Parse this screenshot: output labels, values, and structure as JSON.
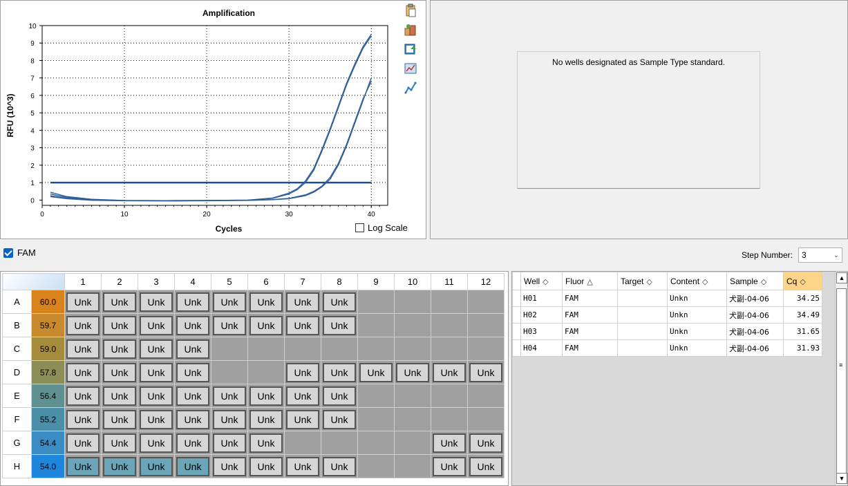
{
  "chart": {
    "title": "Amplification",
    "xlabel": "Cycles",
    "ylabel": "RFU (10^3)",
    "log_scale_label": "Log Scale",
    "log_scale_checked": false
  },
  "chart_data": {
    "type": "line",
    "title": "Amplification",
    "xlabel": "Cycles",
    "ylabel": "RFU (10^3)",
    "xlim": [
      0,
      42
    ],
    "ylim": [
      -0.3,
      10
    ],
    "xticks": [
      0,
      10,
      20,
      30,
      40
    ],
    "yticks": [
      0,
      1,
      2,
      3,
      4,
      5,
      6,
      7,
      8,
      9,
      10
    ],
    "grid": true,
    "threshold": 1.0,
    "series": [
      {
        "values": [
          [
            1,
            0.35
          ],
          [
            3,
            0.15
          ],
          [
            6,
            0.03
          ],
          [
            10,
            -0.02
          ],
          [
            15,
            -0.03
          ],
          [
            20,
            -0.02
          ],
          [
            25,
            0.0
          ],
          [
            28,
            0.1
          ],
          [
            30,
            0.35
          ],
          [
            31,
            0.6
          ],
          [
            32,
            1.0
          ],
          [
            33,
            1.7
          ],
          [
            34,
            2.8
          ],
          [
            35,
            4.0
          ],
          [
            36,
            5.3
          ],
          [
            37,
            6.6
          ],
          [
            38,
            7.7
          ],
          [
            39,
            8.7
          ],
          [
            40,
            9.4
          ]
        ]
      },
      {
        "values": [
          [
            1,
            0.45
          ],
          [
            3,
            0.2
          ],
          [
            6,
            0.05
          ],
          [
            10,
            -0.02
          ],
          [
            15,
            -0.03
          ],
          [
            20,
            -0.02
          ],
          [
            25,
            0.0
          ],
          [
            28,
            0.12
          ],
          [
            30,
            0.4
          ],
          [
            31,
            0.65
          ],
          [
            32,
            1.1
          ],
          [
            33,
            1.8
          ],
          [
            34,
            2.9
          ],
          [
            35,
            4.1
          ],
          [
            36,
            5.4
          ],
          [
            37,
            6.7
          ],
          [
            38,
            7.8
          ],
          [
            39,
            8.8
          ],
          [
            40,
            9.5
          ]
        ]
      },
      {
        "values": [
          [
            1,
            0.25
          ],
          [
            3,
            0.1
          ],
          [
            6,
            0.0
          ],
          [
            10,
            -0.03
          ],
          [
            15,
            -0.04
          ],
          [
            20,
            -0.03
          ],
          [
            25,
            -0.01
          ],
          [
            28,
            0.03
          ],
          [
            30,
            0.1
          ],
          [
            32,
            0.3
          ],
          [
            33,
            0.5
          ],
          [
            34,
            0.8
          ],
          [
            35,
            1.3
          ],
          [
            36,
            2.1
          ],
          [
            37,
            3.2
          ],
          [
            38,
            4.5
          ],
          [
            39,
            5.8
          ],
          [
            40,
            6.8
          ]
        ]
      },
      {
        "values": [
          [
            1,
            0.2
          ],
          [
            3,
            0.08
          ],
          [
            6,
            -0.01
          ],
          [
            10,
            -0.04
          ],
          [
            15,
            -0.05
          ],
          [
            20,
            -0.04
          ],
          [
            25,
            -0.02
          ],
          [
            28,
            0.02
          ],
          [
            30,
            0.08
          ],
          [
            32,
            0.25
          ],
          [
            33,
            0.45
          ],
          [
            34,
            0.75
          ],
          [
            35,
            1.2
          ],
          [
            36,
            2.0
          ],
          [
            37,
            3.1
          ],
          [
            38,
            4.4
          ],
          [
            39,
            5.7
          ],
          [
            40,
            7.0
          ]
        ]
      }
    ]
  },
  "std_curve_message": "No wells designated as Sample Type standard.",
  "fluor_filter": {
    "label": "FAM",
    "checked": true
  },
  "step_number": {
    "label": "Step Number:",
    "value": "3"
  },
  "plate": {
    "columns": [
      "1",
      "2",
      "3",
      "4",
      "5",
      "6",
      "7",
      "8",
      "9",
      "10",
      "11",
      "12"
    ],
    "rows": [
      {
        "label": "A",
        "temp": "60.0",
        "color": "#d8821c",
        "wells": [
          "Unk",
          "Unk",
          "Unk",
          "Unk",
          "Unk",
          "Unk",
          "Unk",
          "Unk",
          "",
          "",
          "",
          ""
        ]
      },
      {
        "label": "B",
        "temp": "59.7",
        "color": "#c88a2c",
        "wells": [
          "Unk",
          "Unk",
          "Unk",
          "Unk",
          "Unk",
          "Unk",
          "Unk",
          "Unk",
          "",
          "",
          "",
          ""
        ]
      },
      {
        "label": "C",
        "temp": "59.0",
        "color": "#a58b3c",
        "wells": [
          "Unk",
          "Unk",
          "Unk",
          "Unk",
          "",
          "",
          "",
          "",
          "",
          "",
          "",
          ""
        ]
      },
      {
        "label": "D",
        "temp": "57.8",
        "color": "#8b8e56",
        "wells": [
          "Unk",
          "Unk",
          "Unk",
          "Unk",
          "",
          "",
          "Unk",
          "Unk",
          "Unk",
          "Unk",
          "Unk",
          "Unk"
        ]
      },
      {
        "label": "E",
        "temp": "56.4",
        "color": "#5f9190",
        "wells": [
          "Unk",
          "Unk",
          "Unk",
          "Unk",
          "Unk",
          "Unk",
          "Unk",
          "Unk",
          "",
          "",
          "",
          ""
        ]
      },
      {
        "label": "F",
        "temp": "55.2",
        "color": "#4a8ea8",
        "wells": [
          "Unk",
          "Unk",
          "Unk",
          "Unk",
          "Unk",
          "Unk",
          "Unk",
          "Unk",
          "",
          "",
          "",
          ""
        ]
      },
      {
        "label": "G",
        "temp": "54.4",
        "color": "#3b8cc2",
        "wells": [
          "Unk",
          "Unk",
          "Unk",
          "Unk",
          "Unk",
          "Unk",
          "",
          "",
          "",
          "",
          "Unk",
          "Unk"
        ]
      },
      {
        "label": "H",
        "temp": "54.0",
        "color": "#1e86dc",
        "wells": [
          "Unk",
          "Unk",
          "Unk",
          "Unk",
          "Unk",
          "Unk",
          "Unk",
          "Unk",
          "",
          "",
          "Unk",
          "Unk"
        ]
      }
    ],
    "selected_wells": [
      "H1",
      "H2",
      "H3",
      "H4"
    ]
  },
  "results_table": {
    "headers": [
      "Well",
      "Fluor",
      "Target",
      "Content",
      "Sample",
      "Cq"
    ],
    "rows": [
      {
        "well": "H01",
        "fluor": "FAM",
        "target": "",
        "content": "Unkn",
        "sample": "犬副-04-06",
        "cq": "34.25"
      },
      {
        "well": "H02",
        "fluor": "FAM",
        "target": "",
        "content": "Unkn",
        "sample": "犬副-04-06",
        "cq": "34.49"
      },
      {
        "well": "H03",
        "fluor": "FAM",
        "target": "",
        "content": "Unkn",
        "sample": "犬副-04-06",
        "cq": "31.65"
      },
      {
        "well": "H04",
        "fluor": "FAM",
        "target": "",
        "content": "Unkn",
        "sample": "犬副-04-06",
        "cq": "31.93"
      }
    ]
  },
  "icons": [
    "clipboard-icon",
    "export-icon",
    "image-export-icon",
    "chart-settings-icon",
    "curve-icon"
  ]
}
